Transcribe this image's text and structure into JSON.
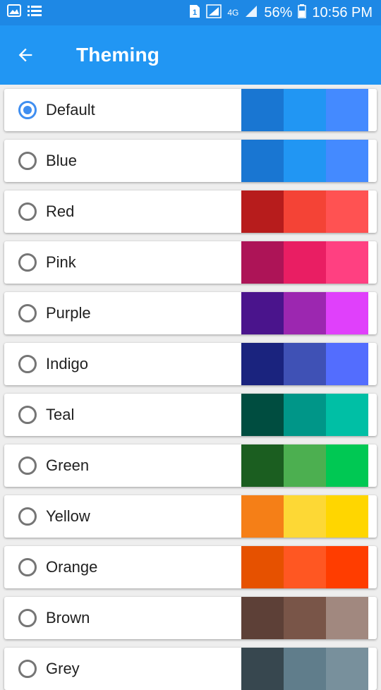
{
  "status_bar": {
    "left_icons": [
      "gallery-icon",
      "list-icon"
    ],
    "sim_label": "1",
    "network_label": "4G",
    "battery": "56%",
    "time": "10:56 PM"
  },
  "app_bar": {
    "back_icon": "arrow-back-icon",
    "title": "Theming"
  },
  "themes": [
    {
      "name": "Default",
      "selected": true,
      "colors": [
        "#1976d2",
        "#2196f3",
        "#448aff"
      ]
    },
    {
      "name": "Blue",
      "selected": false,
      "colors": [
        "#1976d2",
        "#2196f3",
        "#448aff"
      ]
    },
    {
      "name": "Red",
      "selected": false,
      "colors": [
        "#b71c1c",
        "#f44336",
        "#ff5252"
      ]
    },
    {
      "name": "Pink",
      "selected": false,
      "colors": [
        "#ad1457",
        "#e91e63",
        "#ff4081"
      ]
    },
    {
      "name": "Purple",
      "selected": false,
      "colors": [
        "#4a148c",
        "#9c27b0",
        "#e040fb"
      ]
    },
    {
      "name": "Indigo",
      "selected": false,
      "colors": [
        "#1a237e",
        "#3f51b5",
        "#536dfe"
      ]
    },
    {
      "name": "Teal",
      "selected": false,
      "colors": [
        "#004d40",
        "#009688",
        "#00bfa5"
      ]
    },
    {
      "name": "Green",
      "selected": false,
      "colors": [
        "#1b5e20",
        "#4caf50",
        "#00c853"
      ]
    },
    {
      "name": "Yellow",
      "selected": false,
      "colors": [
        "#f57f17",
        "#fdd835",
        "#ffd600"
      ]
    },
    {
      "name": "Orange",
      "selected": false,
      "colors": [
        "#e65100",
        "#ff5722",
        "#ff3d00"
      ]
    },
    {
      "name": "Brown",
      "selected": false,
      "colors": [
        "#5d4037",
        "#795548",
        "#a1887f"
      ]
    },
    {
      "name": "Grey",
      "selected": false,
      "colors": [
        "#37474f",
        "#607d8b",
        "#78909c"
      ]
    }
  ]
}
